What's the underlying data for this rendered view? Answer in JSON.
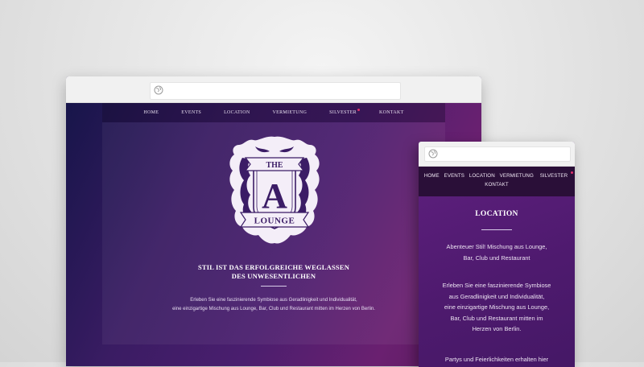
{
  "desktop": {
    "nav": {
      "items": [
        "HOME",
        "EVENTS",
        "LOCATION",
        "VERMIETUNG",
        "SILVESTER",
        "KONTAKT"
      ]
    },
    "logo": {
      "top_word": "THE",
      "letter": "A",
      "bottom_word": "LOUNGE"
    },
    "tagline": {
      "line1": "STIL IST DAS ERFOLGREICHE WEGLASSEN",
      "line2": "DES UNWESENTLICHEN"
    },
    "intro": {
      "line1": "Erleben Sie eine faszinierende Symbiose aus Geradlinigkeit und Individualität,",
      "line2": "eine einzigartige Mischung aus Lounge, Bar, Club und Restaurant mitten im Herzen von Berlin."
    }
  },
  "mobile": {
    "nav": {
      "row1": [
        "HOME",
        "EVENTS",
        "LOCATION",
        "VERMIETUNG",
        "SILVESTER"
      ],
      "row2": [
        "KONTAKT"
      ]
    },
    "title": "LOCATION",
    "para1": {
      "line1": "Abenteuer Stil! Mischung aus Lounge,",
      "line2": "Bar, Club und Restaurant"
    },
    "para2": {
      "line1": "Erleben Sie eine faszinierende Symbiose",
      "line2": "aus Geradlinigkeit und Individualität,",
      "line3": "eine einzigartige Mischung aus Lounge,",
      "line4": "Bar, Club und Restaurant mitten im",
      "line5": "Herzen von Berlin."
    },
    "para3": {
      "line1": "Partys und Feierlichkeiten erhalten hier"
    }
  },
  "colors": {
    "accent_dot": "#e0306a",
    "desktop_bg_dark": "#17154a",
    "desktop_bg_purple": "#6a2070",
    "mobile_bg": "#4e1a6e"
  },
  "icons": {
    "url_bar": "globe-icon",
    "logo": "crest-logo"
  }
}
